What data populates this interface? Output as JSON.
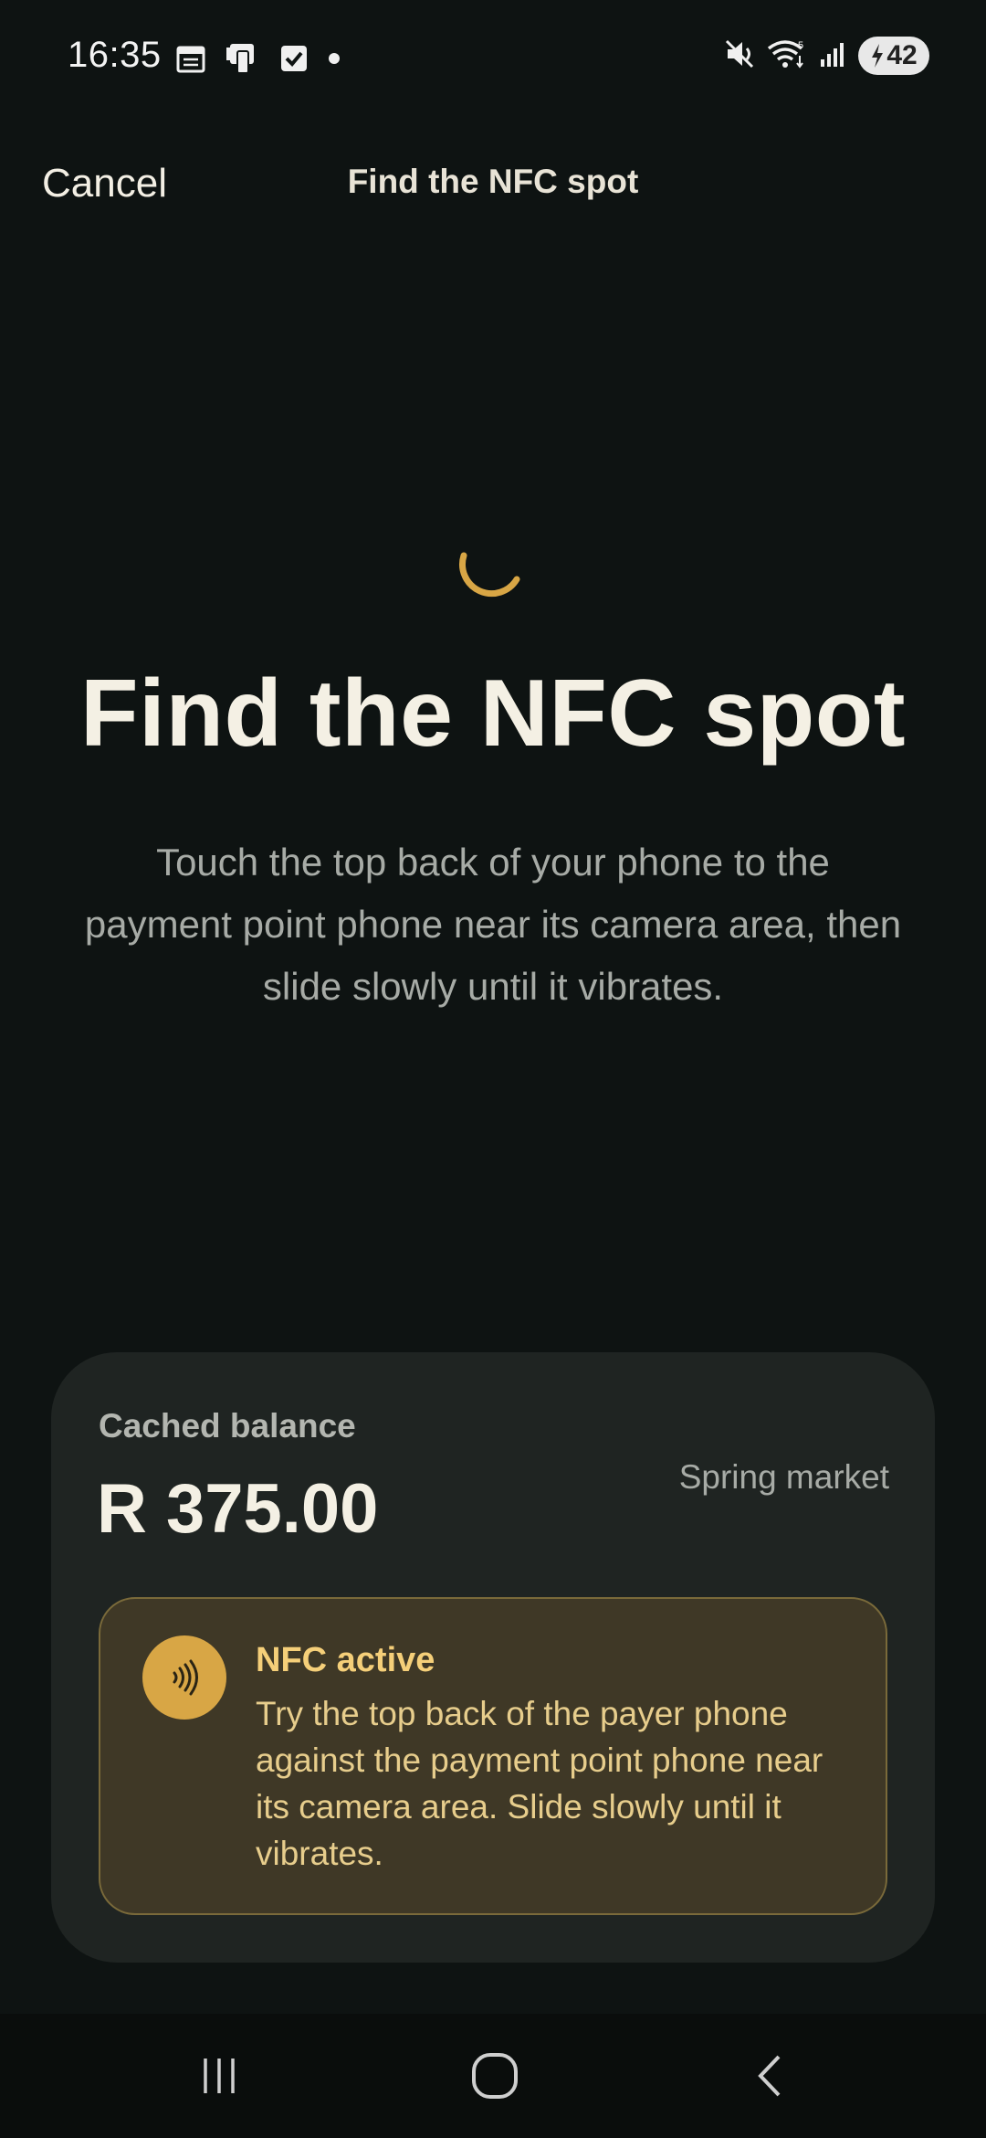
{
  "status_bar": {
    "time": "16:35",
    "battery": "42",
    "left_icons": [
      "calendar-icon",
      "device-icon",
      "checkbox-icon",
      "dot-icon"
    ],
    "right_icons": [
      "mute-icon",
      "wifi-icon",
      "signal-icon",
      "battery-icon"
    ]
  },
  "header": {
    "cancel_label": "Cancel",
    "title": "Find the NFC spot"
  },
  "main": {
    "heading": "Find the NFC spot",
    "instructions": "Touch the top back of your phone to the payment point phone near its camera area, then slide slowly until it vibrates."
  },
  "card": {
    "balance_label": "Cached balance",
    "balance_value": "R 375.00",
    "market": "Spring market",
    "nfc": {
      "title": "NFC active",
      "message": "Try the top back of the payer phone against the payment point phone near its camera area. Slide slowly until it vibrates."
    }
  },
  "colors": {
    "accent": "#d8a645",
    "background": "#0e1312",
    "card": "#1f2422",
    "nfc_box": "#3f3826"
  }
}
